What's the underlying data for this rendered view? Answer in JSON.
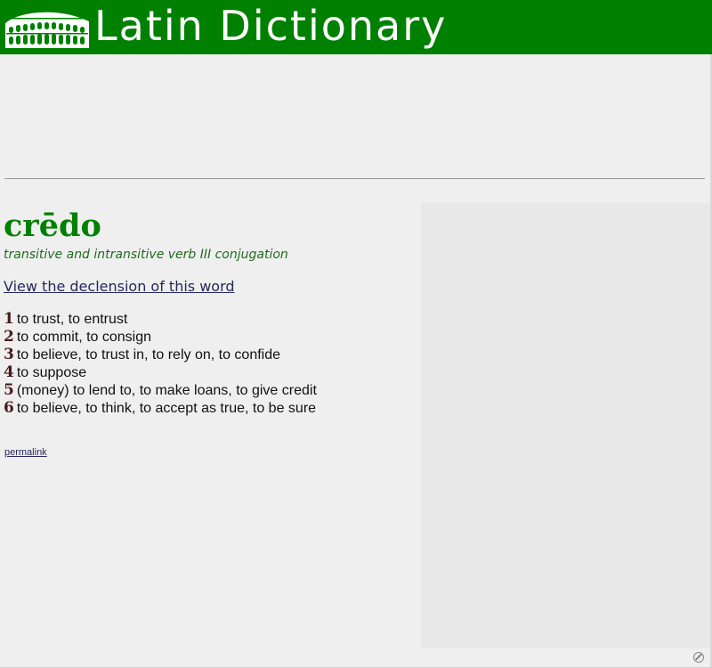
{
  "header": {
    "title": "Latin Dictionary",
    "background": "#008000",
    "logo_icon": "colosseum-icon"
  },
  "entry": {
    "headword": "crēdo",
    "part_of_speech": "transitive and intransitive verb III conjugation",
    "declension_link": "View the declension of this word",
    "definitions": [
      {
        "num": "1",
        "text": "to trust, to entrust"
      },
      {
        "num": "2",
        "text": "to commit, to consign"
      },
      {
        "num": "3",
        "text": "to believe, to trust in, to rely on, to confide"
      },
      {
        "num": "4",
        "text": "to suppose"
      },
      {
        "num": "5",
        "text": "(money) to lend to, to make loans, to give credit"
      },
      {
        "num": "6",
        "text": "to believe, to think, to accept as true, to be sure"
      }
    ],
    "permalink": "permalink"
  },
  "colors": {
    "headword": "#008000",
    "link": "#27275e",
    "page_bg": "#efefef"
  },
  "corner_icon": "no-entry-icon"
}
